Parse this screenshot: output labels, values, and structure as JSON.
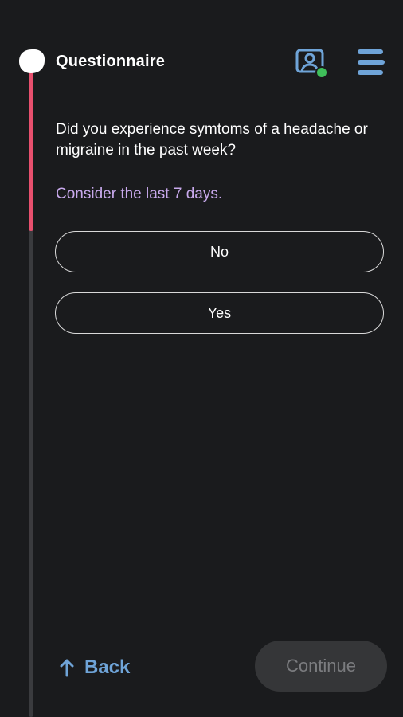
{
  "header": {
    "title": "Questionnaire",
    "avatar_icon": "user-video-icon",
    "status_color": "#3fbf5a",
    "menu_icon": "hamburger-menu-icon"
  },
  "progress": {
    "fill_fraction": 0.26,
    "fill_color": "#e8506e"
  },
  "question": {
    "text": "Did you experience symtoms of a headache or migraine in the past week?",
    "hint": "Consider the last 7 days.",
    "options": [
      {
        "label": "No"
      },
      {
        "label": "Yes"
      }
    ]
  },
  "footer": {
    "back_label": "Back",
    "back_icon": "arrow-up-icon",
    "continue_label": "Continue"
  },
  "colors": {
    "accent": "#6fa4d8",
    "hint": "#c8a9ec",
    "background": "#1a1b1d"
  }
}
